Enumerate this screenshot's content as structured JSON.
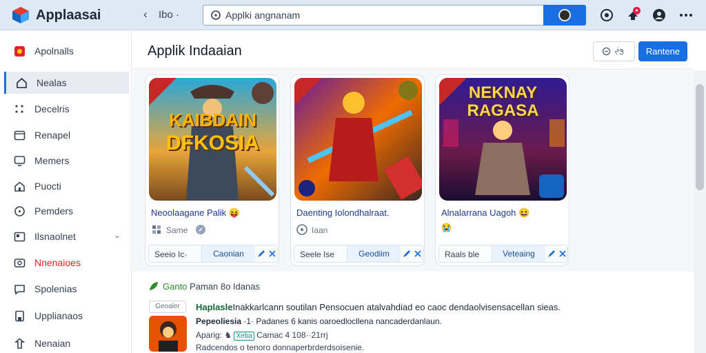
{
  "app": {
    "title": "Applaasai"
  },
  "topbar": {
    "nav_back": "‹",
    "nav_text": "Ibo ·",
    "search_value": "Applki angnanam"
  },
  "sidebar": {
    "items": [
      {
        "label": "Apolnalls",
        "icon": "app-icon"
      },
      {
        "label": "Nealas",
        "icon": "home-icon"
      },
      {
        "label": "Decelris",
        "icon": "grid-icon"
      },
      {
        "label": "Renapel",
        "icon": "window-icon"
      },
      {
        "label": "Memers",
        "icon": "monitor-icon"
      },
      {
        "label": "Puocti",
        "icon": "house-icon"
      },
      {
        "label": "Pemders",
        "icon": "circle-icon"
      },
      {
        "label": "Ilsnaolnet",
        "icon": "folder-icon"
      },
      {
        "label": "Nnenaioes",
        "icon": "camera-icon"
      },
      {
        "label": "Spolenias",
        "icon": "chat-icon"
      },
      {
        "label": "Upplianaos",
        "icon": "doc-icon"
      },
      {
        "label": "Nenaian",
        "icon": "pin-icon"
      }
    ]
  },
  "main": {
    "title": "Applik Indaaian",
    "btn_small": "ᖫᏕ",
    "btn_primary": "Rantene"
  },
  "cards": [
    {
      "art_text1": "KAIBDAIN",
      "art_text2": "DFKOSIA",
      "title": "Neoolaagane Palik 😝",
      "meta": "Same",
      "action_left": "Seeio Ic·",
      "action_mid": "Caonian"
    },
    {
      "title": "Daenting Iolondhalraat.",
      "meta": "Iaan",
      "action_left": "Seele Ise",
      "action_mid": "Geodiim"
    },
    {
      "art_text1": "NEKNAY",
      "art_text2": "RAGASA",
      "title": "Alnalarrana Uagoh 😆",
      "title2": "😭",
      "action_left": "Raals ble",
      "action_mid": "Veteaing"
    }
  ],
  "section": {
    "title_green": "Ganto",
    "title_dark": "Paman 8o Idanas",
    "badge": "Geoaler",
    "line1_bold": "Haplasle",
    "line1_rest": "Inakkarlcann soutilan Pensocuen atalvahdiad eo caoc dendaolvisensacellan sieas.",
    "line2_bold": "Pepeoliesia",
    "line2_rest": "·1· Padanes 6 kanis oaroedlocllena nancaderdanlaun.",
    "line3_a": "Aparig: ♞",
    "line3_tag": "Xeba",
    "line3_b": "Camac 4 108··21rrj",
    "line4": "Radcendos o tenoro  donnaperbrderdsoisenie."
  }
}
